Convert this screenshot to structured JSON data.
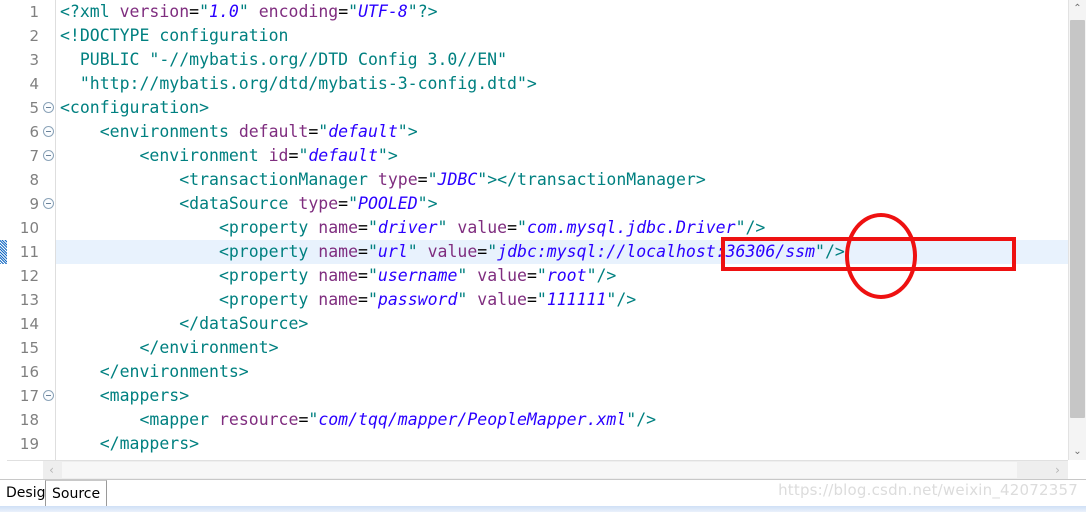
{
  "editor": {
    "current_line": 11,
    "change_marker_line": 11,
    "lines": [
      {
        "number": "1",
        "fold": false,
        "tokens": [
          {
            "t": "tag",
            "s": "<?xml "
          },
          {
            "t": "attr",
            "s": "version"
          },
          {
            "t": "eq",
            "s": "="
          },
          {
            "t": "quote",
            "s": "\""
          },
          {
            "t": "val",
            "s": "1.0"
          },
          {
            "t": "quote",
            "s": "\""
          },
          {
            "t": "plain",
            "s": " "
          },
          {
            "t": "attr",
            "s": "encoding"
          },
          {
            "t": "eq",
            "s": "="
          },
          {
            "t": "quote",
            "s": "\""
          },
          {
            "t": "val",
            "s": "UTF-8"
          },
          {
            "t": "quote",
            "s": "\""
          },
          {
            "t": "tag",
            "s": "?>"
          }
        ]
      },
      {
        "number": "2",
        "fold": false,
        "tokens": [
          {
            "t": "doctype",
            "s": "<!DOCTYPE configuration"
          }
        ]
      },
      {
        "number": "3",
        "fold": false,
        "tokens": [
          {
            "t": "doctype",
            "s": "  PUBLIC \"-//mybatis.org//DTD Config 3.0//EN\""
          }
        ]
      },
      {
        "number": "4",
        "fold": false,
        "tokens": [
          {
            "t": "doctype",
            "s": "  \"http://mybatis.org/dtd/mybatis-3-config.dtd\">"
          }
        ]
      },
      {
        "number": "5",
        "fold": true,
        "tokens": [
          {
            "t": "tag",
            "s": "<configuration>"
          }
        ]
      },
      {
        "number": "6",
        "fold": true,
        "tokens": [
          {
            "t": "tag",
            "s": "    <environments "
          },
          {
            "t": "attr",
            "s": "default"
          },
          {
            "t": "eq",
            "s": "="
          },
          {
            "t": "quote",
            "s": "\""
          },
          {
            "t": "val",
            "s": "default"
          },
          {
            "t": "quote",
            "s": "\""
          },
          {
            "t": "tag",
            "s": ">"
          }
        ]
      },
      {
        "number": "7",
        "fold": true,
        "tokens": [
          {
            "t": "tag",
            "s": "        <environment "
          },
          {
            "t": "attr",
            "s": "id"
          },
          {
            "t": "eq",
            "s": "="
          },
          {
            "t": "quote",
            "s": "\""
          },
          {
            "t": "val",
            "s": "default"
          },
          {
            "t": "quote",
            "s": "\""
          },
          {
            "t": "tag",
            "s": ">"
          }
        ]
      },
      {
        "number": "8",
        "fold": false,
        "tokens": [
          {
            "t": "tag",
            "s": "            <transactionManager "
          },
          {
            "t": "attr",
            "s": "type"
          },
          {
            "t": "eq",
            "s": "="
          },
          {
            "t": "quote",
            "s": "\""
          },
          {
            "t": "val",
            "s": "JDBC"
          },
          {
            "t": "quote",
            "s": "\""
          },
          {
            "t": "tag",
            "s": "></transactionManager>"
          }
        ]
      },
      {
        "number": "9",
        "fold": true,
        "tokens": [
          {
            "t": "tag",
            "s": "            <dataSource "
          },
          {
            "t": "attr",
            "s": "type"
          },
          {
            "t": "eq",
            "s": "="
          },
          {
            "t": "quote",
            "s": "\""
          },
          {
            "t": "val",
            "s": "POOLED"
          },
          {
            "t": "quote",
            "s": "\""
          },
          {
            "t": "tag",
            "s": ">"
          }
        ]
      },
      {
        "number": "10",
        "fold": false,
        "tokens": [
          {
            "t": "tag",
            "s": "                <property "
          },
          {
            "t": "attr",
            "s": "name"
          },
          {
            "t": "eq",
            "s": "="
          },
          {
            "t": "quote",
            "s": "\""
          },
          {
            "t": "val",
            "s": "driver"
          },
          {
            "t": "quote",
            "s": "\""
          },
          {
            "t": "plain",
            "s": " "
          },
          {
            "t": "attr",
            "s": "value"
          },
          {
            "t": "eq",
            "s": "="
          },
          {
            "t": "quote",
            "s": "\""
          },
          {
            "t": "val",
            "s": "com.mysql.jdbc.Driver"
          },
          {
            "t": "quote",
            "s": "\""
          },
          {
            "t": "tag",
            "s": "/>"
          }
        ]
      },
      {
        "number": "11",
        "fold": false,
        "tokens": [
          {
            "t": "tag",
            "s": "                <property "
          },
          {
            "t": "attr",
            "s": "name"
          },
          {
            "t": "eq",
            "s": "="
          },
          {
            "t": "quote",
            "s": "\""
          },
          {
            "t": "val",
            "s": "url"
          },
          {
            "t": "quote",
            "s": "\""
          },
          {
            "t": "plain",
            "s": " "
          },
          {
            "t": "attr",
            "s": "value"
          },
          {
            "t": "eq",
            "s": "="
          },
          {
            "t": "quote",
            "s": "\""
          },
          {
            "t": "val",
            "s": "jdbc:mysql://localhost:36306/ssm"
          },
          {
            "t": "quote",
            "s": "\""
          },
          {
            "t": "tag",
            "s": "/>"
          }
        ]
      },
      {
        "number": "12",
        "fold": false,
        "tokens": [
          {
            "t": "tag",
            "s": "                <property "
          },
          {
            "t": "attr",
            "s": "name"
          },
          {
            "t": "eq",
            "s": "="
          },
          {
            "t": "quote",
            "s": "\""
          },
          {
            "t": "val",
            "s": "username"
          },
          {
            "t": "quote",
            "s": "\""
          },
          {
            "t": "plain",
            "s": " "
          },
          {
            "t": "attr",
            "s": "value"
          },
          {
            "t": "eq",
            "s": "="
          },
          {
            "t": "quote",
            "s": "\""
          },
          {
            "t": "val",
            "s": "root"
          },
          {
            "t": "quote",
            "s": "\""
          },
          {
            "t": "tag",
            "s": "/>"
          }
        ]
      },
      {
        "number": "13",
        "fold": false,
        "tokens": [
          {
            "t": "tag",
            "s": "                <property "
          },
          {
            "t": "attr",
            "s": "name"
          },
          {
            "t": "eq",
            "s": "="
          },
          {
            "t": "quote",
            "s": "\""
          },
          {
            "t": "val",
            "s": "password"
          },
          {
            "t": "quote",
            "s": "\""
          },
          {
            "t": "plain",
            "s": " "
          },
          {
            "t": "attr",
            "s": "value"
          },
          {
            "t": "eq",
            "s": "="
          },
          {
            "t": "quote",
            "s": "\""
          },
          {
            "t": "val",
            "s": "111111"
          },
          {
            "t": "quote",
            "s": "\""
          },
          {
            "t": "tag",
            "s": "/>"
          }
        ]
      },
      {
        "number": "14",
        "fold": false,
        "tokens": [
          {
            "t": "tag",
            "s": "            </dataSource>"
          }
        ]
      },
      {
        "number": "15",
        "fold": false,
        "tokens": [
          {
            "t": "tag",
            "s": "        </environment>"
          }
        ]
      },
      {
        "number": "16",
        "fold": false,
        "tokens": [
          {
            "t": "tag",
            "s": "    </environments>"
          }
        ]
      },
      {
        "number": "17",
        "fold": true,
        "tokens": [
          {
            "t": "tag",
            "s": "    <mappers>"
          }
        ]
      },
      {
        "number": "18",
        "fold": false,
        "tokens": [
          {
            "t": "tag",
            "s": "        <mapper "
          },
          {
            "t": "attr",
            "s": "resource"
          },
          {
            "t": "eq",
            "s": "="
          },
          {
            "t": "quote",
            "s": "\""
          },
          {
            "t": "val",
            "s": "com/tqq/mapper/PeopleMapper.xml"
          },
          {
            "t": "quote",
            "s": "\""
          },
          {
            "t": "tag",
            "s": "/>"
          }
        ]
      },
      {
        "number": "19",
        "fold": false,
        "tokens": [
          {
            "t": "tag",
            "s": "    </mappers>"
          }
        ]
      }
    ]
  },
  "scrollbars": {
    "vertical": {
      "up_arrow": "⌃",
      "down_arrow": "⌄"
    },
    "horizontal": {
      "left_arrow": "‹",
      "right_arrow": "›"
    }
  },
  "tabs": [
    {
      "label": "Design",
      "active": false
    },
    {
      "label": "Source",
      "active": true
    }
  ],
  "watermark": "https://blog.csdn.net/weixin_42072357",
  "annotations": {
    "highlight_color": "#ee1111",
    "rectangle_target": "jdbc:mysql://localhost:36306/ssm",
    "ellipse_target": "36306"
  }
}
